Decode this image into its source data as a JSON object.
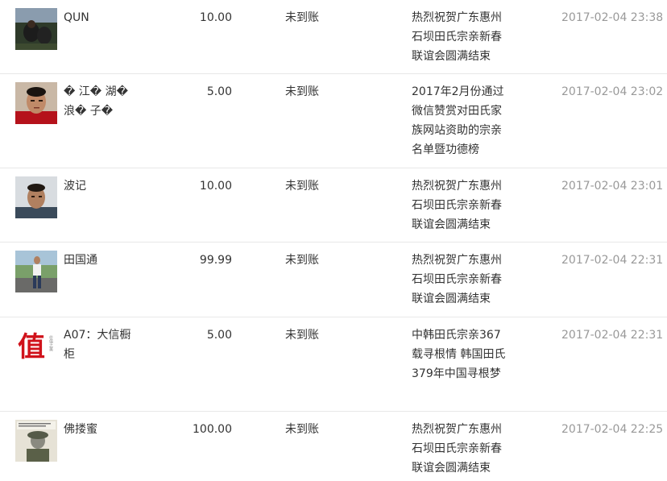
{
  "records": [
    {
      "name": "QUN",
      "amount": "10.00",
      "status": "未到账",
      "note": "热烈祝贺广东惠州石坝田氏宗亲新春联谊会圆满结束",
      "time": "2017-02-04 23:38",
      "avatar": "photo-dark-outdoor"
    },
    {
      "name": "� 江� 湖� 浪� 子�",
      "amount": "5.00",
      "status": "未到账",
      "note": "2017年2月份通过微信赞赏对田氏家族网站资助的宗亲名单暨功德榜",
      "time": "2017-02-04 23:02",
      "avatar": "photo-man-red-shirt"
    },
    {
      "name": "波记",
      "amount": "10.00",
      "status": "未到账",
      "note": "热烈祝贺广东惠州石坝田氏宗亲新春联谊会圆满结束",
      "time": "2017-02-04 23:01",
      "avatar": "photo-man-portrait"
    },
    {
      "name": "田国通",
      "amount": "99.99",
      "status": "未到账",
      "note": "热烈祝贺广东惠州石坝田氏宗亲新春联谊会圆满结束",
      "time": "2017-02-04 22:31",
      "avatar": "photo-man-standing"
    },
    {
      "name": "A07：大信橱柜",
      "amount": "5.00",
      "status": "未到账",
      "note": "中韩田氏宗亲367载寻根情 韩国田氏379年中国寻根梦",
      "time": "2017-02-04 22:31",
      "avatar": "logo-zhi-calligraphy",
      "avatar_text": "值",
      "avatar_subtext": "价值之美"
    },
    {
      "name": "佛搂蜜",
      "amount": "100.00",
      "status": "未到账",
      "note": "热烈祝贺广东惠州石坝田氏宗亲新春联谊会圆满结束",
      "time": "2017-02-04 22:25",
      "avatar": "photo-soldier-poster"
    }
  ],
  "colors": {
    "text": "#333333",
    "time": "#999999",
    "divider": "#e8e8e8",
    "logo_red": "#d0121b"
  }
}
